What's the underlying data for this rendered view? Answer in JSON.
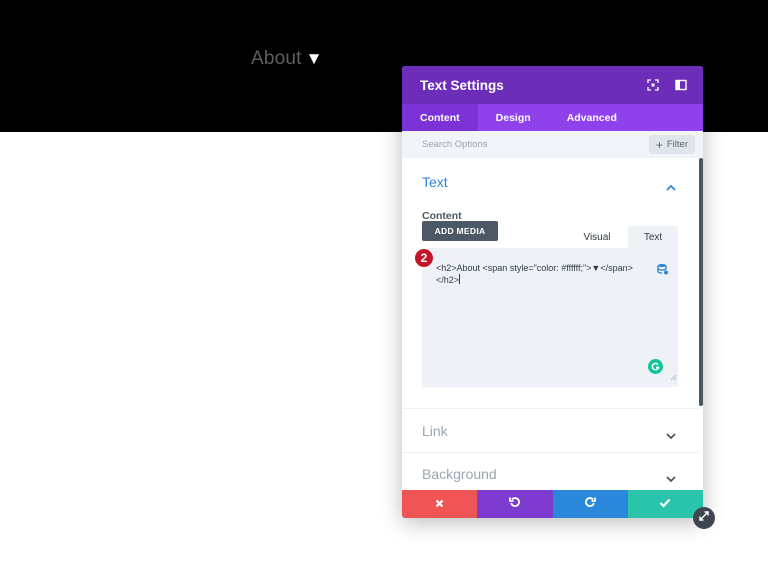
{
  "hero": {
    "heading": "About",
    "arrow": "▼"
  },
  "panel": {
    "title": "Text Settings",
    "tabs": [
      {
        "label": "Content",
        "active": true
      },
      {
        "label": "Design",
        "active": false
      },
      {
        "label": "Advanced",
        "active": false
      }
    ],
    "search": {
      "placeholder": "Search Options"
    },
    "filter": {
      "label": "Filter"
    },
    "text_section": {
      "title": "Text",
      "content_label": "Content",
      "add_media": "ADD MEDIA",
      "editor_tabs": {
        "visual": "Visual",
        "text": "Text"
      },
      "code_line1": "<h2>About <span style=\"color: #ffffff;\">▼</span>",
      "code_line2": "</h2>"
    },
    "collapsed_sections": [
      {
        "label": "Link"
      },
      {
        "label": "Background"
      }
    ]
  },
  "annotation": {
    "step_number": "2"
  },
  "colors": {
    "header": "#6c2eb9",
    "tabs": "#8f42ec",
    "accent_blue": "#2b87da",
    "discard": "#ef5555",
    "undo": "#7e3bd0",
    "redo": "#2b87da",
    "save": "#29c4a9",
    "badge": "#c2162a"
  },
  "icons": {
    "header": [
      "expand-icon",
      "split-view-icon"
    ],
    "footer": [
      "close-icon",
      "undo-icon",
      "redo-icon",
      "check-icon"
    ]
  }
}
